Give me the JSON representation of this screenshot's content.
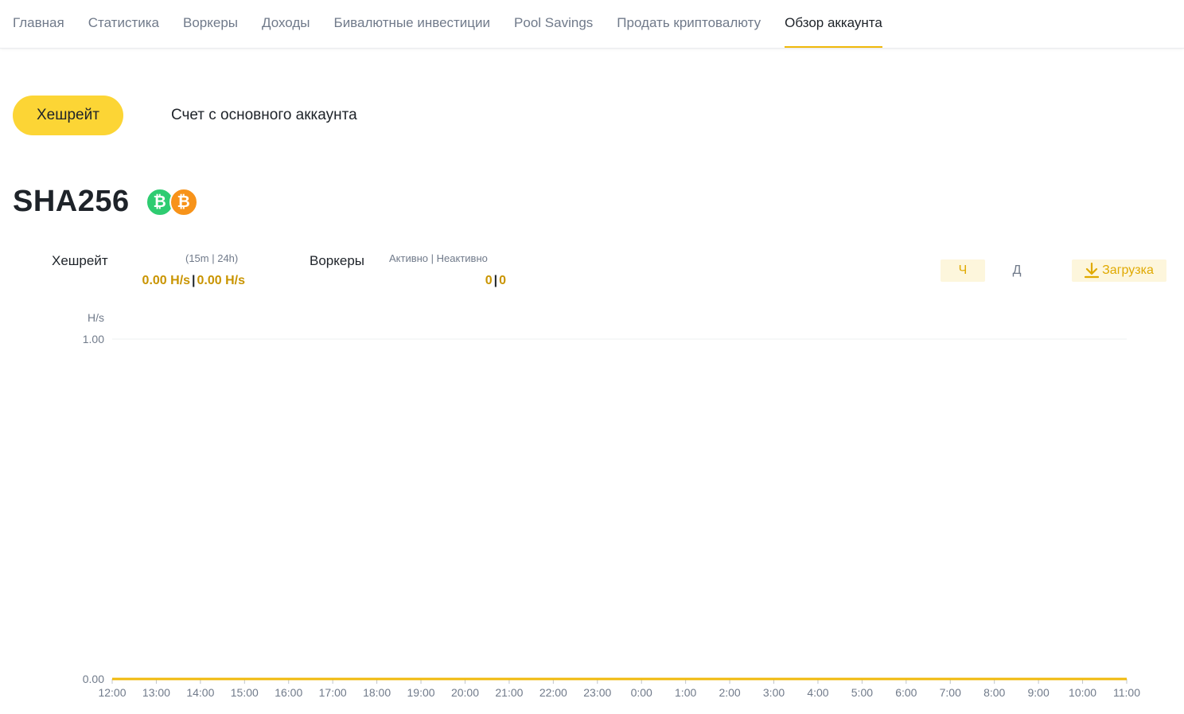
{
  "nav": {
    "tabs": [
      {
        "label": "Главная",
        "active": false
      },
      {
        "label": "Статистика",
        "active": false
      },
      {
        "label": "Воркеры",
        "active": false
      },
      {
        "label": "Доходы",
        "active": false
      },
      {
        "label": "Бивалютные инвестиции",
        "active": false
      },
      {
        "label": "Pool Savings",
        "active": false
      },
      {
        "label": "Продать криптовалюту",
        "active": false
      },
      {
        "label": "Обзор аккаунта",
        "active": true
      }
    ]
  },
  "segment": {
    "active": "Хешрейт",
    "other": "Счет с основного аккаунта"
  },
  "algorithm": {
    "name": "SHA256",
    "coins": [
      {
        "icon": "bch-coin-icon",
        "color": "#2ecc71"
      },
      {
        "icon": "btc-coin-icon",
        "color": "#f7931a"
      }
    ]
  },
  "stats": {
    "hashrate": {
      "label": "Хешрейт",
      "sub": "(15m | 24h)",
      "value_15m": "0.00 H/s",
      "value_24h": "0.00 H/s"
    },
    "workers": {
      "label": "Воркеры",
      "sub": "Активно | Неактивно",
      "active": "0",
      "inactive": "0"
    }
  },
  "controls": {
    "hour": "Ч",
    "day": "Д",
    "download": "Загрузка"
  },
  "colors": {
    "accent": "#fcd535",
    "accent_dark": "#f0b90b",
    "value": "#c99400",
    "muted": "#707a8a"
  },
  "chart_data": {
    "type": "line",
    "ylabel": "H/s",
    "ylim": [
      0,
      1
    ],
    "yticks": [
      "1.00",
      "0.00"
    ],
    "categories": [
      "12:00",
      "13:00",
      "14:00",
      "15:00",
      "16:00",
      "17:00",
      "18:00",
      "19:00",
      "20:00",
      "21:00",
      "22:00",
      "23:00",
      "0:00",
      "1:00",
      "2:00",
      "3:00",
      "4:00",
      "5:00",
      "6:00",
      "7:00",
      "8:00",
      "9:00",
      "10:00",
      "11:00"
    ],
    "series": [
      {
        "values": [
          0,
          0,
          0,
          0,
          0,
          0,
          0,
          0,
          0,
          0,
          0,
          0,
          0,
          0,
          0,
          0,
          0,
          0,
          0,
          0,
          0,
          0,
          0,
          0
        ],
        "color": "#f0b90b"
      }
    ]
  }
}
